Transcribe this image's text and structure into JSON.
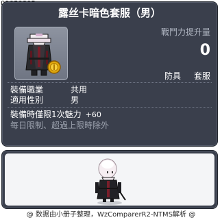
{
  "item": {
    "id": "01050805",
    "title": "露丝卡暗色套服（男）",
    "icon": "dark-suit-with-gold-coin-icon"
  },
  "stats": {
    "power_label": "戰鬥力提升量",
    "power_value": "0"
  },
  "tags": {
    "category": "防具",
    "type": "套服"
  },
  "requirements": {
    "job_label": "裝備職業",
    "job_value": "共用",
    "gender_label": "適用性別",
    "gender_value": "男"
  },
  "effects": {
    "limit_text": "裝備時僅限1次魅力",
    "limit_bonus": "+60",
    "note": "每日限制、超過上限時除外"
  },
  "preview": {
    "icon": "character-preview"
  },
  "footer": {
    "credit": "@ 数据由小册子整理，WzComparerR2-NTMS解析 @"
  },
  "colors": {
    "panel": "#3a3f4c",
    "text": "#ffffff",
    "muted": "#9aa0ac",
    "power_label": "#aeb4c0"
  }
}
